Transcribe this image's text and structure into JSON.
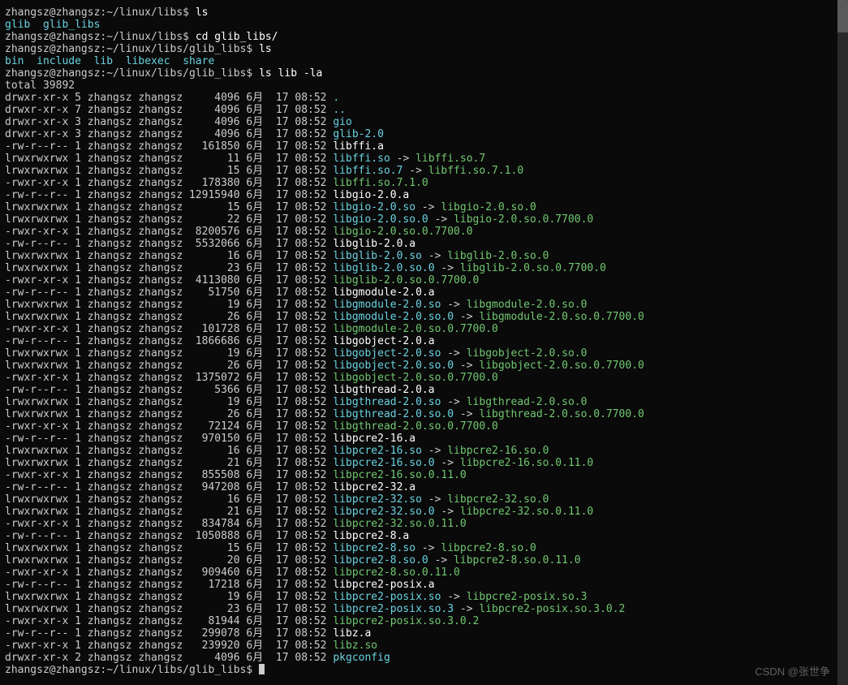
{
  "prompts": [
    {
      "path": "zhangsz@zhangsz:~/linux/libs$",
      "cmd": "ls"
    },
    {
      "dirs": [
        "glib",
        "glib_libs"
      ]
    },
    {
      "path": "zhangsz@zhangsz:~/linux/libs$",
      "cmd": "cd glib_libs/"
    },
    {
      "path": "zhangsz@zhangsz:~/linux/libs/glib_libs$",
      "cmd": "ls"
    },
    {
      "dirs": [
        "bin",
        "include",
        "lib",
        "libexec",
        "share"
      ]
    },
    {
      "path": "zhangsz@zhangsz:~/linux/libs/glib_libs$",
      "cmd": "ls lib -la"
    }
  ],
  "total": "total 39892",
  "rows": [
    {
      "perm": "drwxr-xr-x",
      "n": "5",
      "own": "zhangsz",
      "grp": "zhangsz",
      "size": "4096",
      "mon": "6月",
      "day": "17",
      "time": "08:52",
      "name": ".",
      "ncls": "c"
    },
    {
      "perm": "drwxr-xr-x",
      "n": "7",
      "own": "zhangsz",
      "grp": "zhangsz",
      "size": "4096",
      "mon": "6月",
      "day": "17",
      "time": "08:52",
      "name": "..",
      "ncls": "c"
    },
    {
      "perm": "drwxr-xr-x",
      "n": "3",
      "own": "zhangsz",
      "grp": "zhangsz",
      "size": "4096",
      "mon": "6月",
      "day": "17",
      "time": "08:52",
      "name": "gio",
      "ncls": "c"
    },
    {
      "perm": "drwxr-xr-x",
      "n": "3",
      "own": "zhangsz",
      "grp": "zhangsz",
      "size": "4096",
      "mon": "6月",
      "day": "17",
      "time": "08:52",
      "name": "glib-2.0",
      "ncls": "c"
    },
    {
      "perm": "-rw-r--r--",
      "n": "1",
      "own": "zhangsz",
      "grp": "zhangsz",
      "size": "161850",
      "mon": "6月",
      "day": "17",
      "time": "08:52",
      "name": "libffi.a",
      "ncls": "w"
    },
    {
      "perm": "lrwxrwxrwx",
      "n": "1",
      "own": "zhangsz",
      "grp": "zhangsz",
      "size": "11",
      "mon": "6月",
      "day": "17",
      "time": "08:52",
      "name": "libffi.so",
      "ncls": "c",
      "target": "libffi.so.7",
      "tcls": "g"
    },
    {
      "perm": "lrwxrwxrwx",
      "n": "1",
      "own": "zhangsz",
      "grp": "zhangsz",
      "size": "15",
      "mon": "6月",
      "day": "17",
      "time": "08:52",
      "name": "libffi.so.7",
      "ncls": "c",
      "target": "libffi.so.7.1.0",
      "tcls": "g"
    },
    {
      "perm": "-rwxr-xr-x",
      "n": "1",
      "own": "zhangsz",
      "grp": "zhangsz",
      "size": "178380",
      "mon": "6月",
      "day": "17",
      "time": "08:52",
      "name": "libffi.so.7.1.0",
      "ncls": "g"
    },
    {
      "perm": "-rw-r--r--",
      "n": "1",
      "own": "zhangsz",
      "grp": "zhangsz",
      "size": "12915940",
      "mon": "6月",
      "day": "17",
      "time": "08:52",
      "name": "libgio-2.0.a",
      "ncls": "w"
    },
    {
      "perm": "lrwxrwxrwx",
      "n": "1",
      "own": "zhangsz",
      "grp": "zhangsz",
      "size": "15",
      "mon": "6月",
      "day": "17",
      "time": "08:52",
      "name": "libgio-2.0.so",
      "ncls": "c",
      "target": "libgio-2.0.so.0",
      "tcls": "g"
    },
    {
      "perm": "lrwxrwxrwx",
      "n": "1",
      "own": "zhangsz",
      "grp": "zhangsz",
      "size": "22",
      "mon": "6月",
      "day": "17",
      "time": "08:52",
      "name": "libgio-2.0.so.0",
      "ncls": "c",
      "target": "libgio-2.0.so.0.7700.0",
      "tcls": "g"
    },
    {
      "perm": "-rwxr-xr-x",
      "n": "1",
      "own": "zhangsz",
      "grp": "zhangsz",
      "size": "8200576",
      "mon": "6月",
      "day": "17",
      "time": "08:52",
      "name": "libgio-2.0.so.0.7700.0",
      "ncls": "g"
    },
    {
      "perm": "-rw-r--r--",
      "n": "1",
      "own": "zhangsz",
      "grp": "zhangsz",
      "size": "5532066",
      "mon": "6月",
      "day": "17",
      "time": "08:52",
      "name": "libglib-2.0.a",
      "ncls": "w"
    },
    {
      "perm": "lrwxrwxrwx",
      "n": "1",
      "own": "zhangsz",
      "grp": "zhangsz",
      "size": "16",
      "mon": "6月",
      "day": "17",
      "time": "08:52",
      "name": "libglib-2.0.so",
      "ncls": "c",
      "target": "libglib-2.0.so.0",
      "tcls": "g"
    },
    {
      "perm": "lrwxrwxrwx",
      "n": "1",
      "own": "zhangsz",
      "grp": "zhangsz",
      "size": "23",
      "mon": "6月",
      "day": "17",
      "time": "08:52",
      "name": "libglib-2.0.so.0",
      "ncls": "c",
      "target": "libglib-2.0.so.0.7700.0",
      "tcls": "g"
    },
    {
      "perm": "-rwxr-xr-x",
      "n": "1",
      "own": "zhangsz",
      "grp": "zhangsz",
      "size": "4113080",
      "mon": "6月",
      "day": "17",
      "time": "08:52",
      "name": "libglib-2.0.so.0.7700.0",
      "ncls": "g"
    },
    {
      "perm": "-rw-r--r--",
      "n": "1",
      "own": "zhangsz",
      "grp": "zhangsz",
      "size": "51750",
      "mon": "6月",
      "day": "17",
      "time": "08:52",
      "name": "libgmodule-2.0.a",
      "ncls": "w"
    },
    {
      "perm": "lrwxrwxrwx",
      "n": "1",
      "own": "zhangsz",
      "grp": "zhangsz",
      "size": "19",
      "mon": "6月",
      "day": "17",
      "time": "08:52",
      "name": "libgmodule-2.0.so",
      "ncls": "c",
      "target": "libgmodule-2.0.so.0",
      "tcls": "g"
    },
    {
      "perm": "lrwxrwxrwx",
      "n": "1",
      "own": "zhangsz",
      "grp": "zhangsz",
      "size": "26",
      "mon": "6月",
      "day": "17",
      "time": "08:52",
      "name": "libgmodule-2.0.so.0",
      "ncls": "c",
      "target": "libgmodule-2.0.so.0.7700.0",
      "tcls": "g"
    },
    {
      "perm": "-rwxr-xr-x",
      "n": "1",
      "own": "zhangsz",
      "grp": "zhangsz",
      "size": "101728",
      "mon": "6月",
      "day": "17",
      "time": "08:52",
      "name": "libgmodule-2.0.so.0.7700.0",
      "ncls": "g"
    },
    {
      "perm": "-rw-r--r--",
      "n": "1",
      "own": "zhangsz",
      "grp": "zhangsz",
      "size": "1866686",
      "mon": "6月",
      "day": "17",
      "time": "08:52",
      "name": "libgobject-2.0.a",
      "ncls": "w"
    },
    {
      "perm": "lrwxrwxrwx",
      "n": "1",
      "own": "zhangsz",
      "grp": "zhangsz",
      "size": "19",
      "mon": "6月",
      "day": "17",
      "time": "08:52",
      "name": "libgobject-2.0.so",
      "ncls": "c",
      "target": "libgobject-2.0.so.0",
      "tcls": "g"
    },
    {
      "perm": "lrwxrwxrwx",
      "n": "1",
      "own": "zhangsz",
      "grp": "zhangsz",
      "size": "26",
      "mon": "6月",
      "day": "17",
      "time": "08:52",
      "name": "libgobject-2.0.so.0",
      "ncls": "c",
      "target": "libgobject-2.0.so.0.7700.0",
      "tcls": "g"
    },
    {
      "perm": "-rwxr-xr-x",
      "n": "1",
      "own": "zhangsz",
      "grp": "zhangsz",
      "size": "1375072",
      "mon": "6月",
      "day": "17",
      "time": "08:52",
      "name": "libgobject-2.0.so.0.7700.0",
      "ncls": "g"
    },
    {
      "perm": "-rw-r--r--",
      "n": "1",
      "own": "zhangsz",
      "grp": "zhangsz",
      "size": "5366",
      "mon": "6月",
      "day": "17",
      "time": "08:52",
      "name": "libgthread-2.0.a",
      "ncls": "w"
    },
    {
      "perm": "lrwxrwxrwx",
      "n": "1",
      "own": "zhangsz",
      "grp": "zhangsz",
      "size": "19",
      "mon": "6月",
      "day": "17",
      "time": "08:52",
      "name": "libgthread-2.0.so",
      "ncls": "c",
      "target": "libgthread-2.0.so.0",
      "tcls": "g"
    },
    {
      "perm": "lrwxrwxrwx",
      "n": "1",
      "own": "zhangsz",
      "grp": "zhangsz",
      "size": "26",
      "mon": "6月",
      "day": "17",
      "time": "08:52",
      "name": "libgthread-2.0.so.0",
      "ncls": "c",
      "target": "libgthread-2.0.so.0.7700.0",
      "tcls": "g"
    },
    {
      "perm": "-rwxr-xr-x",
      "n": "1",
      "own": "zhangsz",
      "grp": "zhangsz",
      "size": "72124",
      "mon": "6月",
      "day": "17",
      "time": "08:52",
      "name": "libgthread-2.0.so.0.7700.0",
      "ncls": "g"
    },
    {
      "perm": "-rw-r--r--",
      "n": "1",
      "own": "zhangsz",
      "grp": "zhangsz",
      "size": "970150",
      "mon": "6月",
      "day": "17",
      "time": "08:52",
      "name": "libpcre2-16.a",
      "ncls": "w"
    },
    {
      "perm": "lrwxrwxrwx",
      "n": "1",
      "own": "zhangsz",
      "grp": "zhangsz",
      "size": "16",
      "mon": "6月",
      "day": "17",
      "time": "08:52",
      "name": "libpcre2-16.so",
      "ncls": "c",
      "target": "libpcre2-16.so.0",
      "tcls": "g"
    },
    {
      "perm": "lrwxrwxrwx",
      "n": "1",
      "own": "zhangsz",
      "grp": "zhangsz",
      "size": "21",
      "mon": "6月",
      "day": "17",
      "time": "08:52",
      "name": "libpcre2-16.so.0",
      "ncls": "c",
      "target": "libpcre2-16.so.0.11.0",
      "tcls": "g"
    },
    {
      "perm": "-rwxr-xr-x",
      "n": "1",
      "own": "zhangsz",
      "grp": "zhangsz",
      "size": "855508",
      "mon": "6月",
      "day": "17",
      "time": "08:52",
      "name": "libpcre2-16.so.0.11.0",
      "ncls": "g"
    },
    {
      "perm": "-rw-r--r--",
      "n": "1",
      "own": "zhangsz",
      "grp": "zhangsz",
      "size": "947208",
      "mon": "6月",
      "day": "17",
      "time": "08:52",
      "name": "libpcre2-32.a",
      "ncls": "w"
    },
    {
      "perm": "lrwxrwxrwx",
      "n": "1",
      "own": "zhangsz",
      "grp": "zhangsz",
      "size": "16",
      "mon": "6月",
      "day": "17",
      "time": "08:52",
      "name": "libpcre2-32.so",
      "ncls": "c",
      "target": "libpcre2-32.so.0",
      "tcls": "g"
    },
    {
      "perm": "lrwxrwxrwx",
      "n": "1",
      "own": "zhangsz",
      "grp": "zhangsz",
      "size": "21",
      "mon": "6月",
      "day": "17",
      "time": "08:52",
      "name": "libpcre2-32.so.0",
      "ncls": "c",
      "target": "libpcre2-32.so.0.11.0",
      "tcls": "g"
    },
    {
      "perm": "-rwxr-xr-x",
      "n": "1",
      "own": "zhangsz",
      "grp": "zhangsz",
      "size": "834784",
      "mon": "6月",
      "day": "17",
      "time": "08:52",
      "name": "libpcre2-32.so.0.11.0",
      "ncls": "g"
    },
    {
      "perm": "-rw-r--r--",
      "n": "1",
      "own": "zhangsz",
      "grp": "zhangsz",
      "size": "1050888",
      "mon": "6月",
      "day": "17",
      "time": "08:52",
      "name": "libpcre2-8.a",
      "ncls": "w"
    },
    {
      "perm": "lrwxrwxrwx",
      "n": "1",
      "own": "zhangsz",
      "grp": "zhangsz",
      "size": "15",
      "mon": "6月",
      "day": "17",
      "time": "08:52",
      "name": "libpcre2-8.so",
      "ncls": "c",
      "target": "libpcre2-8.so.0",
      "tcls": "g"
    },
    {
      "perm": "lrwxrwxrwx",
      "n": "1",
      "own": "zhangsz",
      "grp": "zhangsz",
      "size": "20",
      "mon": "6月",
      "day": "17",
      "time": "08:52",
      "name": "libpcre2-8.so.0",
      "ncls": "c",
      "target": "libpcre2-8.so.0.11.0",
      "tcls": "g"
    },
    {
      "perm": "-rwxr-xr-x",
      "n": "1",
      "own": "zhangsz",
      "grp": "zhangsz",
      "size": "909460",
      "mon": "6月",
      "day": "17",
      "time": "08:52",
      "name": "libpcre2-8.so.0.11.0",
      "ncls": "g"
    },
    {
      "perm": "-rw-r--r--",
      "n": "1",
      "own": "zhangsz",
      "grp": "zhangsz",
      "size": "17218",
      "mon": "6月",
      "day": "17",
      "time": "08:52",
      "name": "libpcre2-posix.a",
      "ncls": "w"
    },
    {
      "perm": "lrwxrwxrwx",
      "n": "1",
      "own": "zhangsz",
      "grp": "zhangsz",
      "size": "19",
      "mon": "6月",
      "day": "17",
      "time": "08:52",
      "name": "libpcre2-posix.so",
      "ncls": "c",
      "target": "libpcre2-posix.so.3",
      "tcls": "g"
    },
    {
      "perm": "lrwxrwxrwx",
      "n": "1",
      "own": "zhangsz",
      "grp": "zhangsz",
      "size": "23",
      "mon": "6月",
      "day": "17",
      "time": "08:52",
      "name": "libpcre2-posix.so.3",
      "ncls": "c",
      "target": "libpcre2-posix.so.3.0.2",
      "tcls": "g"
    },
    {
      "perm": "-rwxr-xr-x",
      "n": "1",
      "own": "zhangsz",
      "grp": "zhangsz",
      "size": "81944",
      "mon": "6月",
      "day": "17",
      "time": "08:52",
      "name": "libpcre2-posix.so.3.0.2",
      "ncls": "g"
    },
    {
      "perm": "-rw-r--r--",
      "n": "1",
      "own": "zhangsz",
      "grp": "zhangsz",
      "size": "299078",
      "mon": "6月",
      "day": "17",
      "time": "08:52",
      "name": "libz.a",
      "ncls": "w"
    },
    {
      "perm": "-rwxr-xr-x",
      "n": "1",
      "own": "zhangsz",
      "grp": "zhangsz",
      "size": "239920",
      "mon": "6月",
      "day": "17",
      "time": "08:52",
      "name": "libz.so",
      "ncls": "g"
    },
    {
      "perm": "drwxr-xr-x",
      "n": "2",
      "own": "zhangsz",
      "grp": "zhangsz",
      "size": "4096",
      "mon": "6月",
      "day": "17",
      "time": "08:52",
      "name": "pkgconfig",
      "ncls": "c"
    }
  ],
  "final_prompt": {
    "path": "zhangsz@zhangsz:~/linux/libs/glib_libs$"
  },
  "watermark": "CSDN @张世争"
}
